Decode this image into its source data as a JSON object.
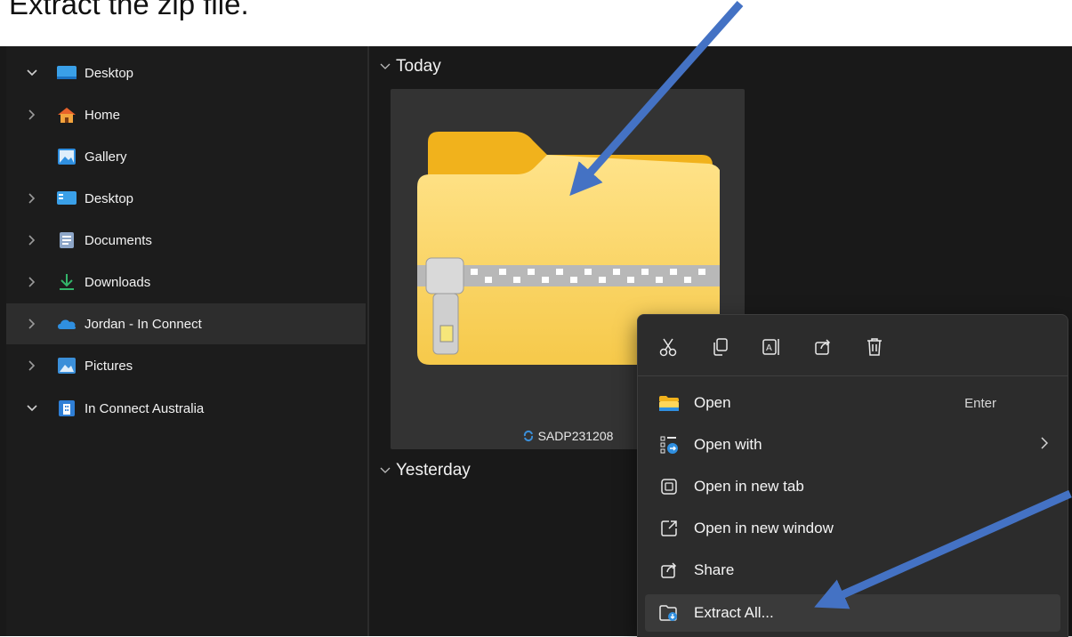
{
  "caption": "Extract the zip file.",
  "sidebar": {
    "items": [
      {
        "label": "Desktop",
        "chevron": "down",
        "icon": "desktop-icon"
      },
      {
        "label": "Home",
        "chevron": "right",
        "icon": "home-icon"
      },
      {
        "label": "Gallery",
        "chevron": "none",
        "icon": "gallery-icon"
      },
      {
        "label": "Desktop",
        "chevron": "right",
        "icon": "desktop-icon"
      },
      {
        "label": "Documents",
        "chevron": "right",
        "icon": "documents-icon"
      },
      {
        "label": "Downloads",
        "chevron": "right",
        "icon": "download-icon"
      },
      {
        "label": "Jordan - In Connect",
        "chevron": "right",
        "icon": "onedrive-cloud-icon",
        "selected": true
      },
      {
        "label": "Pictures",
        "chevron": "right",
        "icon": "pictures-icon"
      },
      {
        "label": "In Connect Australia",
        "chevron": "down",
        "icon": "building-icon"
      }
    ]
  },
  "content": {
    "groups": [
      {
        "label": "Today"
      },
      {
        "label": "Yesterday"
      }
    ],
    "file": {
      "name": "SADP231208",
      "icon": "zip-folder-icon",
      "status_icon": "sync-icon"
    }
  },
  "context_menu": {
    "quick_actions": [
      "cut-icon",
      "copy-icon",
      "rename-icon",
      "share-icon",
      "delete-icon"
    ],
    "items": [
      {
        "label": "Open",
        "shortcut": "Enter",
        "icon": "folder-icon"
      },
      {
        "label": "Open with",
        "submenu": true,
        "icon": "open-with-icon"
      },
      {
        "label": "Open in new tab",
        "icon": "new-tab-icon"
      },
      {
        "label": "Open in new window",
        "icon": "new-window-icon"
      },
      {
        "label": "Share",
        "icon": "share-icon"
      },
      {
        "label": "Extract All...",
        "icon": "extract-icon",
        "highlighted": true
      }
    ]
  },
  "colors": {
    "annotation_arrow": "#4472c4",
    "explorer_bg": "#191919",
    "menu_bg": "#2c2c2c"
  }
}
